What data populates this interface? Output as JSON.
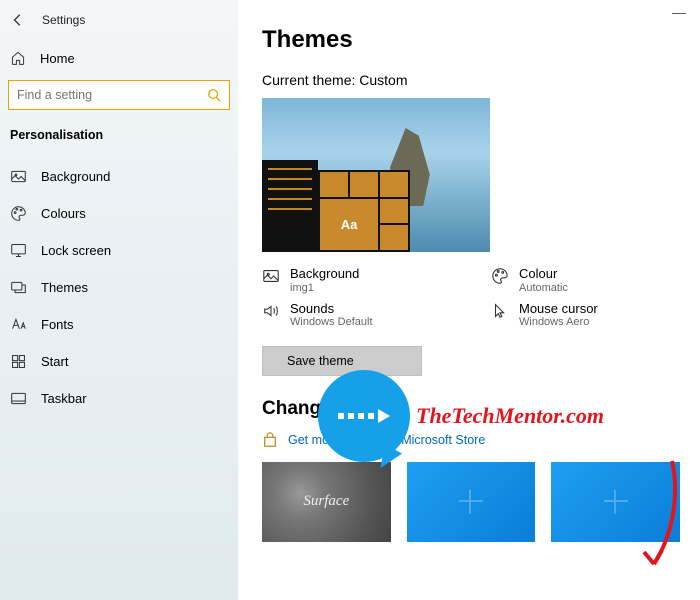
{
  "app": {
    "title": "Settings"
  },
  "sidebar": {
    "home": "Home",
    "search_placeholder": "Find a setting",
    "section": "Personalisation",
    "items": [
      {
        "label": "Background"
      },
      {
        "label": "Colours"
      },
      {
        "label": "Lock screen"
      },
      {
        "label": "Themes"
      },
      {
        "label": "Fonts"
      },
      {
        "label": "Start"
      },
      {
        "label": "Taskbar"
      }
    ]
  },
  "main": {
    "heading": "Themes",
    "current_label": "Current theme: Custom",
    "preview_tile_text": "Aa",
    "specs": {
      "background": {
        "label": "Background",
        "value": "img1"
      },
      "colour": {
        "label": "Colour",
        "value": "Automatic"
      },
      "sounds": {
        "label": "Sounds",
        "value": "Windows Default"
      },
      "cursor": {
        "label": "Mouse cursor",
        "value": "Windows Aero"
      }
    },
    "save_button": "Save theme",
    "change_heading": "Change theme",
    "store_link": "Get more themes in Microsoft Store",
    "thumbs": {
      "surface": "Surface"
    }
  },
  "overlay": {
    "brand": "TheTechMentor.com"
  }
}
